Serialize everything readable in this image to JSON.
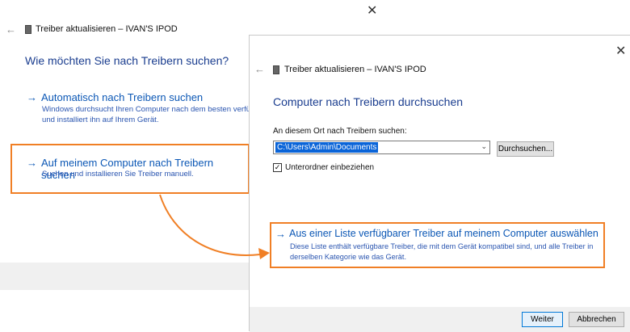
{
  "back_window": {
    "title": "Treiber aktualisieren – IVAN'S IPOD",
    "heading": "Wie möchten Sie nach Treibern suchen?",
    "close_glyph": "✕",
    "back_glyph": "←",
    "option1": {
      "arrow": "→",
      "title": "Automatisch nach Treibern suchen",
      "desc_line1": "Windows durchsucht Ihren Computer nach dem besten verfügbar",
      "desc_line2": "und installiert ihn auf Ihrem Gerät."
    },
    "option2": {
      "arrow": "→",
      "title": "Auf meinem Computer nach Treibern suchen",
      "desc": "Suchen und installieren Sie Treiber manuell."
    }
  },
  "front_dialog": {
    "title": "Treiber aktualisieren – IVAN'S IPOD",
    "close_glyph": "✕",
    "back_glyph": "←",
    "heading": "Computer nach Treibern durchsuchen",
    "path_label": "An diesem Ort nach Treibern suchen:",
    "path_value": "C:\\Users\\Admin\\Documents",
    "chevron_glyph": "⌄",
    "browse_button": "Durchsuchen...",
    "include_subfolders": "Unterordner einbeziehen",
    "checkbox_glyph": "✓",
    "list_option": {
      "arrow": "→",
      "title": "Aus einer Liste verfügbarer Treiber auf meinem Computer auswählen",
      "desc_line1": "Diese Liste enthält verfügbare Treiber, die mit dem Gerät kompatibel sind, und alle Treiber in",
      "desc_line2": "derselben Kategorie wie das Gerät."
    },
    "next_button": "Weiter",
    "cancel_button": "Abbrechen"
  },
  "colors": {
    "annotation_orange": "#f07f25",
    "link_blue": "#0b57b5",
    "selection_blue": "#0a64d8"
  }
}
